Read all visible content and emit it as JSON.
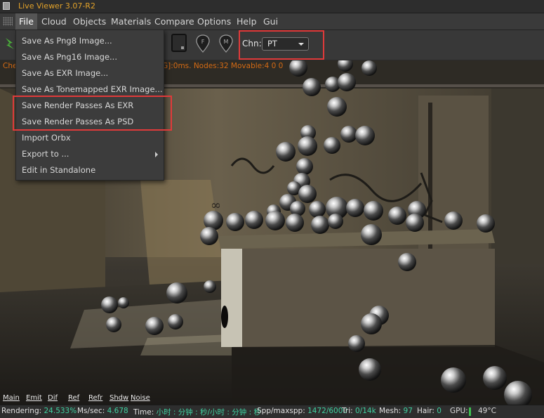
{
  "window": {
    "title": "Live Viewer 3.07-R2"
  },
  "menubar": {
    "items": [
      "File",
      "Cloud",
      "Objects",
      "Materials",
      "Compare",
      "Options",
      "Help",
      "Gui"
    ],
    "active": "File"
  },
  "toolbar": {
    "chn_label": "Chn:",
    "chn_value": "PT",
    "pin_f": "F",
    "pin_m": "M"
  },
  "infoline": {
    "left": "Che",
    "right": "G]:0ms. Nodes:32 Movable:4  0 0"
  },
  "file_menu": {
    "items": [
      {
        "label": "Save As Png8 Image...",
        "submenu": false
      },
      {
        "label": "Save As Png16 Image...",
        "submenu": false
      },
      {
        "label": "Save As EXR Image...",
        "submenu": false
      },
      {
        "label": "Save As Tonemapped EXR Image...",
        "submenu": false
      },
      {
        "label": "Save Render Passes As EXR",
        "submenu": false
      },
      {
        "label": "Save Render Passes As PSD",
        "submenu": false
      },
      {
        "label": "Import Orbx",
        "submenu": false
      },
      {
        "label": "Export to ...",
        "submenu": true
      },
      {
        "label": "Edit in Standalone",
        "submenu": false
      }
    ]
  },
  "pass_tabs": [
    "Main",
    "Emit",
    "Dif",
    "Ref",
    "Refr",
    "Shdw",
    "Noise"
  ],
  "status": {
    "rendering_label": "Rendering:",
    "rendering_value": "24.533%",
    "mssec_label": "Ms/sec:",
    "mssec_value": "4.678",
    "time_label": "Time:",
    "time_value": "小时 : 分钟 : 秒/小时 : 分钟 : 秒",
    "spp_label": "Spp/maxspp:",
    "spp_value": "1472/6000",
    "tri_label": "Tri:",
    "tri_value": "0/14k",
    "mesh_label": "Mesh:",
    "mesh_value": "97",
    "hair_label": "Hair:",
    "hair_value": "0",
    "gpu_label": "GPU:",
    "gpu_value": "49°C"
  },
  "colors": {
    "title": "#e2a22a",
    "info": "#d46a14",
    "status_value": "#3fd0a0",
    "highlight_box": "#e03a3a"
  },
  "icons": [
    "app-icon",
    "menu-grip-icon",
    "octane-logo-icon",
    "region-select-icon",
    "pin-f-icon",
    "pin-m-icon",
    "chevron-down-icon",
    "submenu-arrow-icon"
  ]
}
